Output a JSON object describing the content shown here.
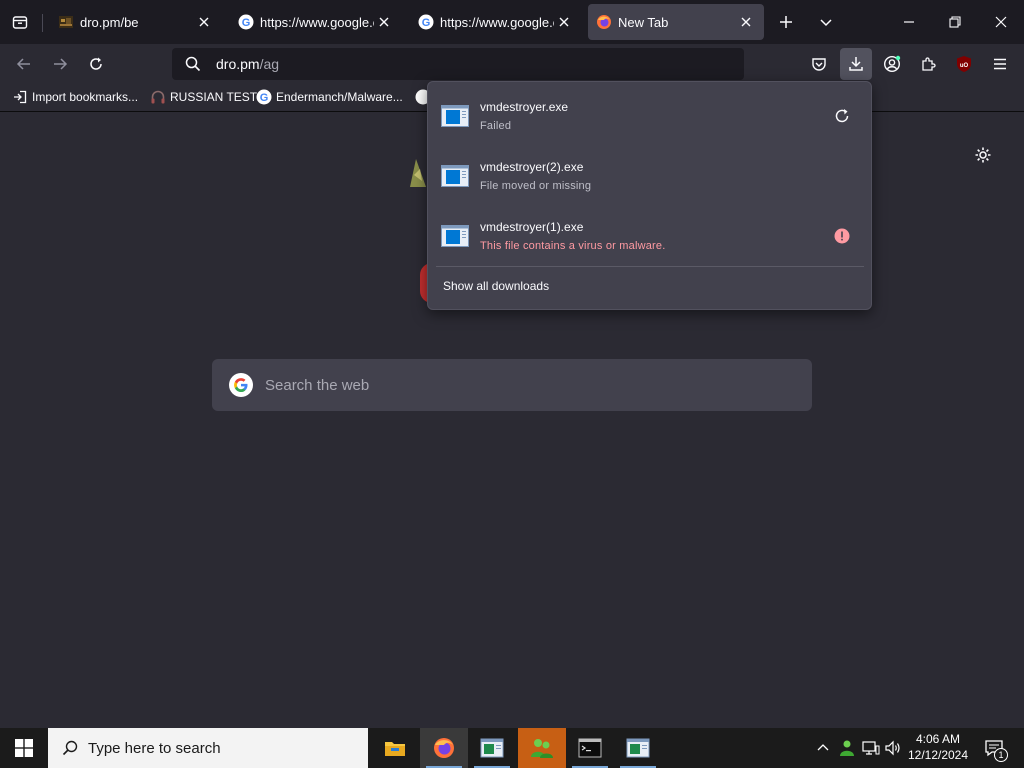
{
  "tabs": [
    {
      "title": "dro.pm/be",
      "favicon": "pixel-image-icon",
      "active": false
    },
    {
      "title": "https://www.google.co",
      "favicon": "google-icon",
      "active": false
    },
    {
      "title": "https://www.google.co",
      "favicon": "google-icon",
      "active": false
    },
    {
      "title": "New Tab",
      "favicon": "firefox-icon",
      "active": true
    }
  ],
  "urlbar": {
    "host": "dro.pm",
    "path": "/ag"
  },
  "bookmarks": [
    {
      "label": "Import bookmarks...",
      "icon": "import-icon"
    },
    {
      "label": "RUSSIAN TEST",
      "icon": "headphones-icon"
    },
    {
      "label": "Endermanch/Malware...",
      "icon": "google-icon"
    }
  ],
  "downloads": {
    "items": [
      {
        "name": "vmdestroyer.exe",
        "status": "Failed",
        "action": "retry-icon"
      },
      {
        "name": "vmdestroyer(2).exe",
        "status": "File moved or missing",
        "action": ""
      },
      {
        "name": "vmdestroyer(1).exe",
        "status": "This file contains a virus or malware.",
        "action": "warning-icon"
      }
    ],
    "show_all": "Show all downloads"
  },
  "newtab": {
    "search_placeholder": "Search the web"
  },
  "taskbar": {
    "search_placeholder": "Type here to search",
    "time": "4:06 AM",
    "date": "12/12/2024",
    "notification_count": "1"
  },
  "colors": {
    "accent_blue": "#0078d4",
    "warning_red": "#ff9aa2",
    "panel_bg": "#42414d",
    "taskbar_highlight": "#c75f14"
  }
}
